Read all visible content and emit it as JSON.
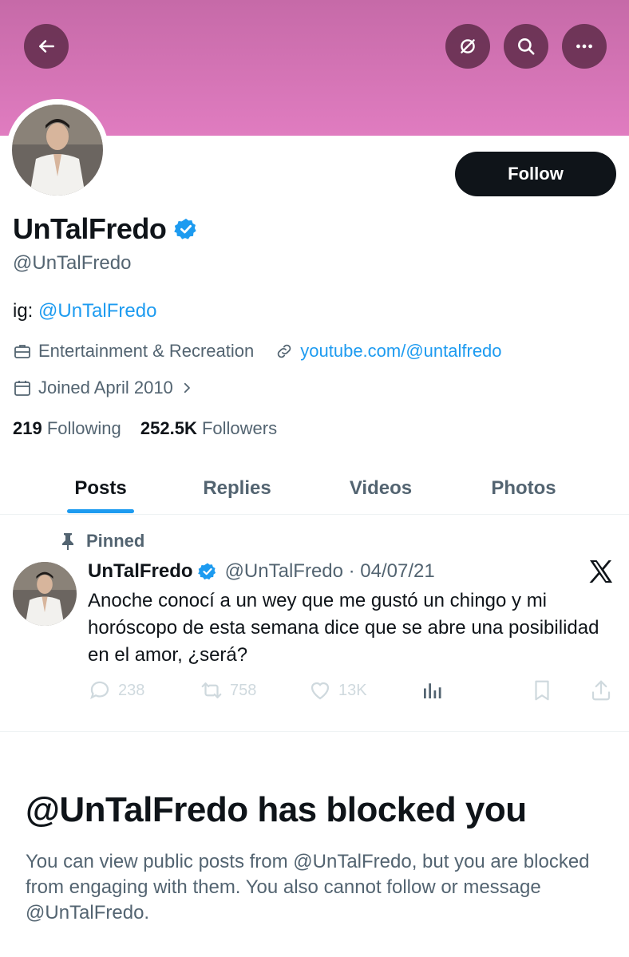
{
  "header": {
    "back_icon": "arrow-left-icon",
    "mute_icon": "eye-slash-icon",
    "search_icon": "search-icon",
    "more_icon": "more-icon"
  },
  "profile": {
    "follow_label": "Follow",
    "name": "UnTalFredo",
    "handle": "@UnTalFredo",
    "bio_prefix": "ig: ",
    "bio_link": "@UnTalFredo",
    "category": "Entertainment & Recreation",
    "website": "youtube.com/@untalfredo",
    "joined": "Joined April 2010",
    "following_count": "219",
    "following_label": " Following",
    "followers_count": "252.5K",
    "followers_label": " Followers"
  },
  "tabs": [
    {
      "label": "Posts"
    },
    {
      "label": "Replies"
    },
    {
      "label": "Videos"
    },
    {
      "label": "Photos"
    }
  ],
  "post": {
    "pinned_label": "Pinned",
    "name": "UnTalFredo",
    "meta": "@UnTalFredo · 04/07/21",
    "text": "Anoche conocí a un wey que me gustó un chingo y mi horóscopo de esta semana dice que se abre una posibilidad en el amor, ¿será?",
    "replies": "238",
    "reposts": "758",
    "likes": "13K"
  },
  "blocked": {
    "title": "@UnTalFredo has blocked you",
    "message": "You can view public posts from @UnTalFredo, but you are blocked from engaging with them. You also cannot follow or message @UnTalFredo."
  },
  "colors": {
    "accent": "#1d9bf0",
    "banner": "#e07cc0",
    "text": "#0f1419",
    "muted": "#536471"
  }
}
